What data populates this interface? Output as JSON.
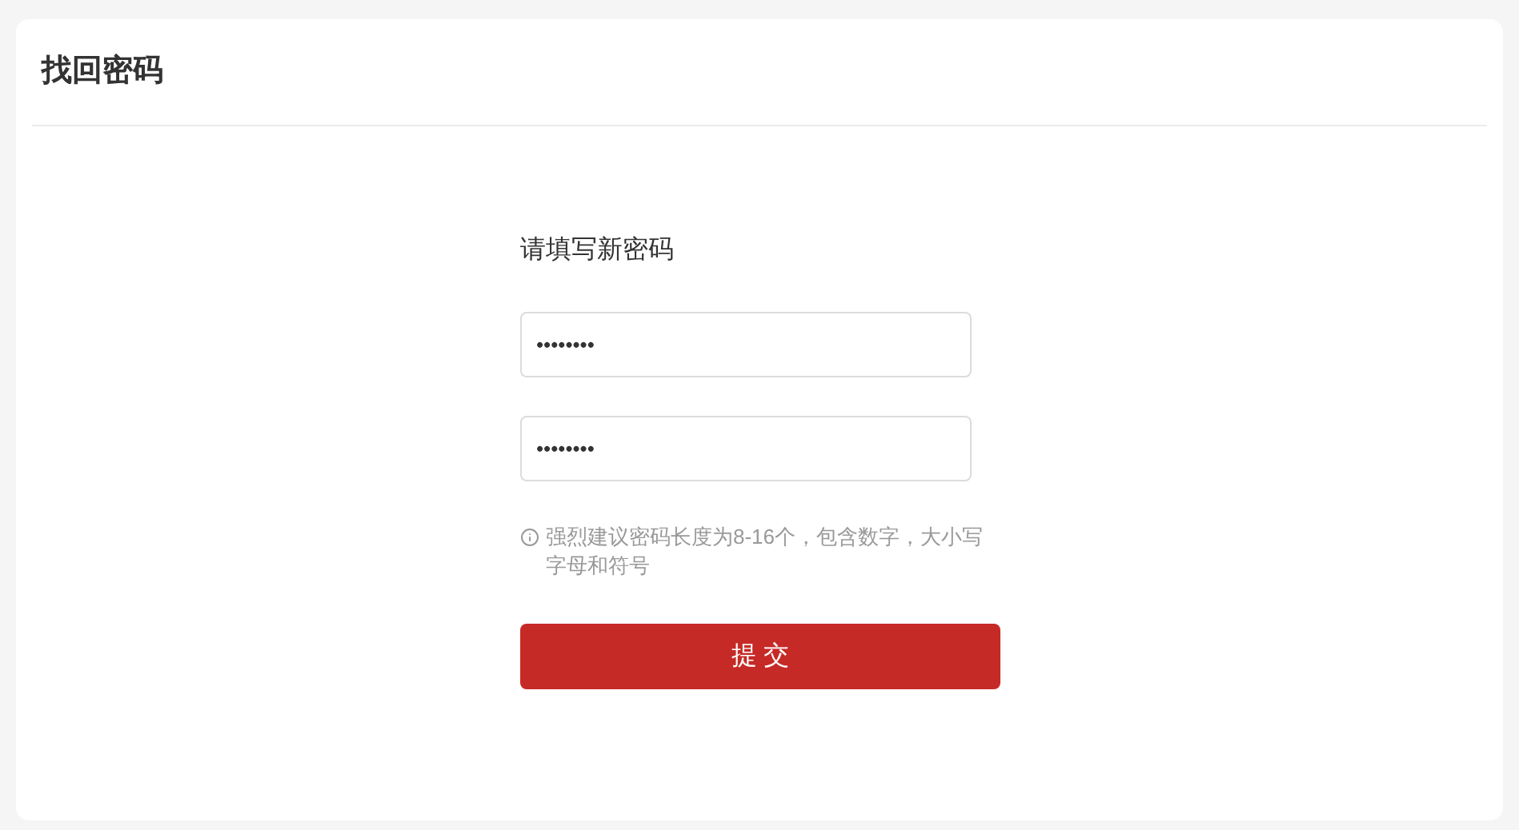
{
  "page_title": "找回密码",
  "form": {
    "heading": "请填写新密码",
    "fields": [
      {
        "value": "••••••••"
      },
      {
        "value": "••••••••"
      }
    ],
    "hint": "强烈建议密码长度为8-16个，包含数字，大小写字母和符号",
    "submit": "提 交"
  }
}
